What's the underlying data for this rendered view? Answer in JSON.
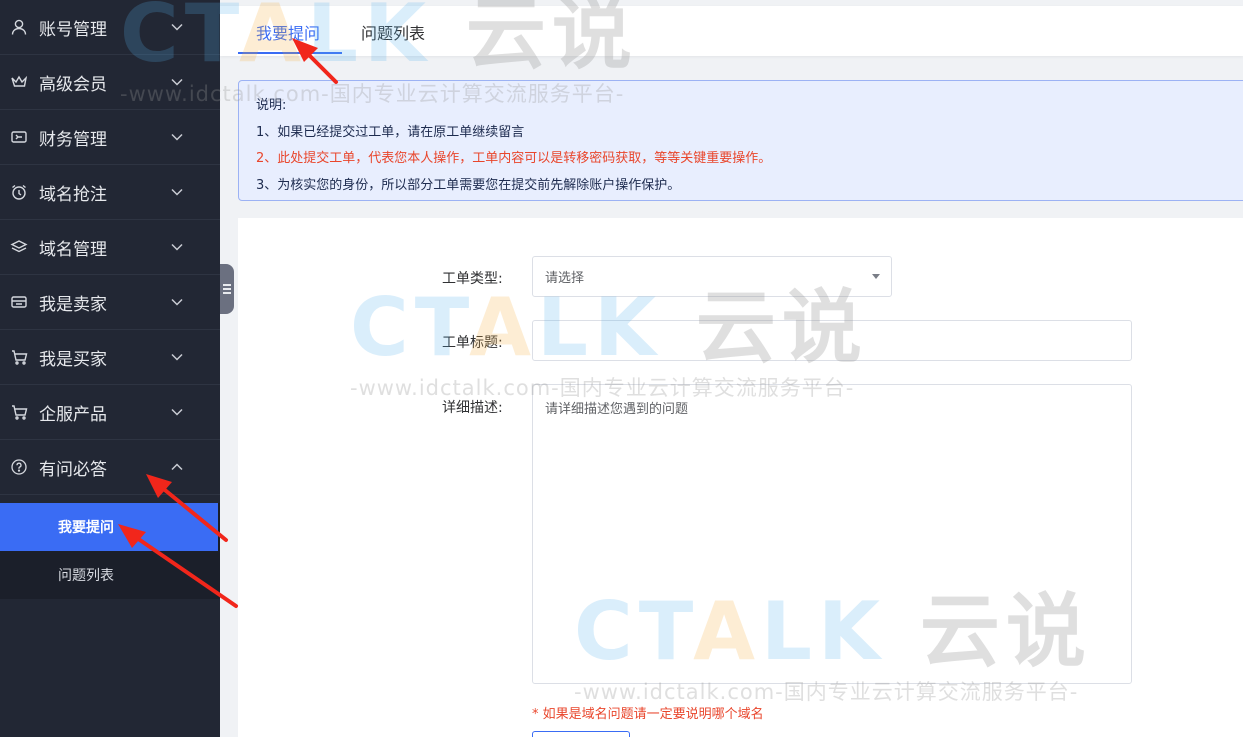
{
  "sidebar": {
    "items": [
      {
        "label": "账号管理",
        "icon": "user-icon"
      },
      {
        "label": "高级会员",
        "icon": "crown-icon"
      },
      {
        "label": "财务管理",
        "icon": "wallet-icon"
      },
      {
        "label": "域名抢注",
        "icon": "alarm-clock-icon"
      },
      {
        "label": "域名管理",
        "icon": "layers-icon"
      },
      {
        "label": "我是卖家",
        "icon": "store-icon"
      },
      {
        "label": "我是买家",
        "icon": "cart-icon"
      },
      {
        "label": "企服产品",
        "icon": "cart-icon"
      },
      {
        "label": "有问必答",
        "icon": "question-circle-icon"
      }
    ],
    "submenu": [
      {
        "label": "我要提问"
      },
      {
        "label": "问题列表"
      }
    ]
  },
  "tabs": [
    {
      "label": "我要提问"
    },
    {
      "label": "问题列表"
    }
  ],
  "notice": {
    "title": "说明:",
    "line1": "1、如果已经提交过工单，请在原工单继续留言",
    "line2": "2、此处提交工单，代表您本人操作，工单内容可以是转移密码获取，等等关键重要操作。",
    "line3": "3、为核实您的身份，所以部分工单需要您在提交前先解除账户操作保护。"
  },
  "form": {
    "type_label": "工单类型:",
    "type_placeholder": "请选择",
    "title_label": "工单标题:",
    "title_value": "",
    "desc_label": "详细描述:",
    "desc_placeholder": "请详细描述您遇到的问题",
    "hint": "* 如果是域名问题请一定要说明哪个域名"
  },
  "watermark": {
    "brand_c": "C",
    "brand_talk_t": "T",
    "brand_talk_a": "A",
    "brand_talk_lk": "LK",
    "brand_cn": "云说",
    "sub": "-www.idctalk.com-国内专业云计算交流服务平台-"
  },
  "colors": {
    "sidebar_bg": "#222734",
    "accent": "#3a6cf4",
    "warning_red": "#e9462c",
    "arrow_red": "#f1261b"
  }
}
